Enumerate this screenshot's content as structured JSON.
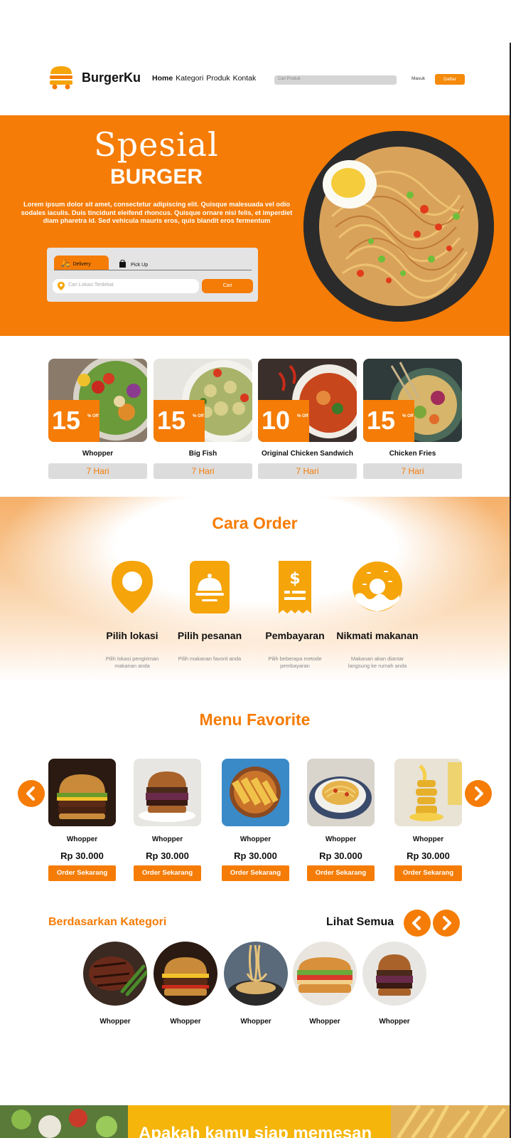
{
  "brand": {
    "name": "BurgerKu"
  },
  "nav": {
    "items": [
      {
        "label": "Home"
      },
      {
        "label": "Kategori"
      },
      {
        "label": "Produk"
      },
      {
        "label": "Kontak"
      }
    ]
  },
  "header": {
    "search_placeholder": "Cari Produk",
    "login_label": "Masuk",
    "register_label": "Daftar"
  },
  "hero": {
    "title_script": "Spesial",
    "title_bold": "BURGER",
    "description": "Lorem ipsum dolor sit amet, consectetur adipiscing elit. Quisque malesuada vel odio sodales iaculis. Duis tincidunt eleifend rhoncus. Quisque ornare nisi felis, et imperdiet diam pharetra id. Sed vehicula mauris eros, quis blandit eros fermentum",
    "tab_delivery": "Delivery",
    "tab_pickup": "Pick Up",
    "location_placeholder": "Cari Lokasi Terdekat",
    "search_button": "Cari"
  },
  "promos": [
    {
      "discount": "15",
      "unit": "% Off",
      "name": "Whopper",
      "days": "7 Hari"
    },
    {
      "discount": "15",
      "unit": "% Off",
      "name": "Big Fish",
      "days": "7 Hari"
    },
    {
      "discount": "10",
      "unit": "% Off",
      "name": "Original  Chicken Sandwich",
      "days": "7 Hari"
    },
    {
      "discount": "15",
      "unit": "% Off",
      "name": "Chicken Fries",
      "days": "7 Hari"
    }
  ],
  "cara_order": {
    "title": "Cara Order",
    "steps": [
      {
        "title": "Pilih lokasi",
        "desc": "Pilih lokasi pengiriman makanan anda",
        "icon": "location-pin-icon"
      },
      {
        "title": "Pilih pesanan",
        "desc": "Pilih makanan favorit anda",
        "icon": "food-cloche-icon"
      },
      {
        "title": "Pembayaran",
        "desc": "Pilih beberapa metode pembayaran",
        "icon": "receipt-icon"
      },
      {
        "title": "Nikmati makanan",
        "desc": "Makanan akan diantar langsung ke rumah anda",
        "icon": "donut-icon"
      }
    ]
  },
  "menu_favorite": {
    "title": "Menu Favorite",
    "items": [
      {
        "name": "Whopper",
        "price": "Rp 30.000",
        "button": "Order Sekarang"
      },
      {
        "name": "Whopper",
        "price": "Rp 30.000",
        "button": "Order Sekarang"
      },
      {
        "name": "Whopper",
        "price": "Rp 30.000",
        "button": "Order Sekarang"
      },
      {
        "name": "Whopper",
        "price": "Rp 30.000",
        "button": "Order Sekarang"
      },
      {
        "name": "Whopper",
        "price": "Rp 30.000",
        "button": "Order Sekarang"
      }
    ]
  },
  "kategori": {
    "title": "Berdasarkan Kategori",
    "see_all": "Lihat Semua",
    "items": [
      {
        "name": "Whopper"
      },
      {
        "name": "Whopper"
      },
      {
        "name": "Whopper"
      },
      {
        "name": "Whopper"
      },
      {
        "name": "Whopper"
      }
    ]
  },
  "banner": {
    "text": "Apakah kamu siap memesan"
  },
  "colors": {
    "accent": "#f57c06",
    "accent_light": "#f5b50a",
    "muted": "#dcdcdc"
  }
}
